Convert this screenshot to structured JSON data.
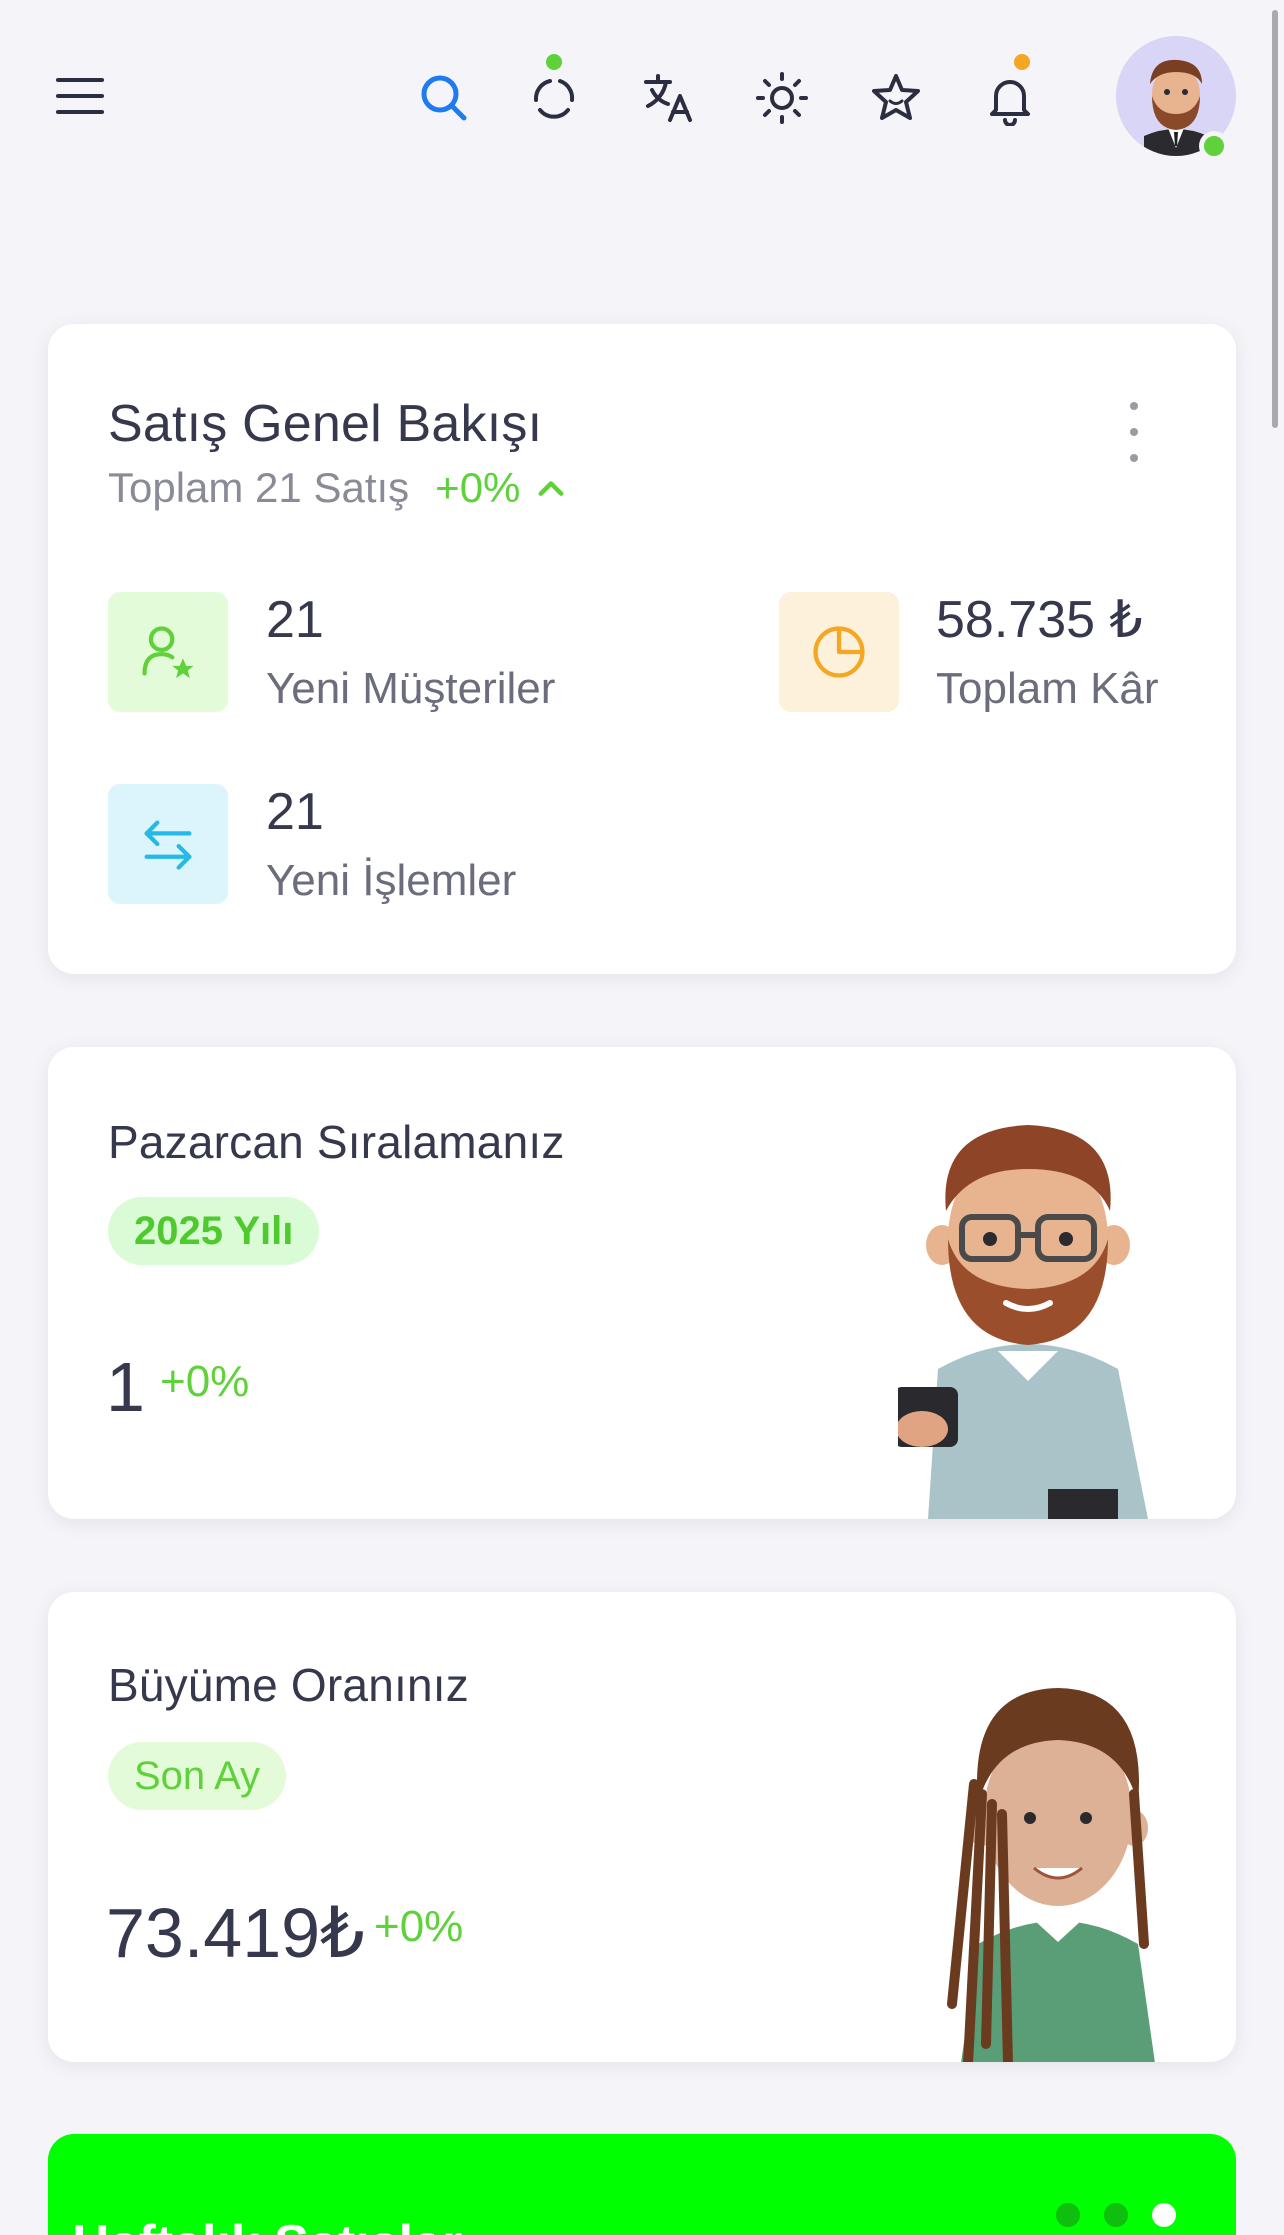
{
  "header": {
    "icons": [
      "menu-icon",
      "search-icon",
      "refresh-icon",
      "translate-icon",
      "theme-icon",
      "favorites-icon",
      "notifications-icon"
    ],
    "colors": {
      "search": "#1e7bf0",
      "icon": "#2b2d40",
      "refresh_dot": "#5fd13a",
      "bell_dot": "#f5a623",
      "online": "#5fd13a"
    }
  },
  "sales_overview": {
    "title": "Satış Genel Bakışı",
    "subtitle": "Toplam 21 Satış",
    "trend": "+0%",
    "stats": [
      {
        "value": "21",
        "label": "Yeni Müşteriler",
        "icon": "user-star-icon",
        "color": "#5fd13a",
        "bg": "#e4fbd9"
      },
      {
        "value": "58.735 ₺",
        "label": "Toplam Kâr",
        "icon": "pie-chart-icon",
        "color": "#f5a623",
        "bg": "#fdf1dc"
      },
      {
        "value": "21",
        "label": "Yeni İşlemler",
        "icon": "transfer-arrows-icon",
        "color": "#26b9e8",
        "bg": "#dcf4fc"
      }
    ]
  },
  "ranking_card": {
    "title": "Pazarcan Sıralamanız",
    "chip": "2025 Yılı",
    "value": "1",
    "change": "+0%"
  },
  "growth_card": {
    "title": "Büyüme Oranınız",
    "chip": "Son Ay",
    "value": "73.419₺",
    "change": "+0%"
  },
  "weekly_card": {
    "title": "Haftalık Satışlar",
    "pager": [
      "dot",
      "dot",
      "dot-active"
    ]
  }
}
